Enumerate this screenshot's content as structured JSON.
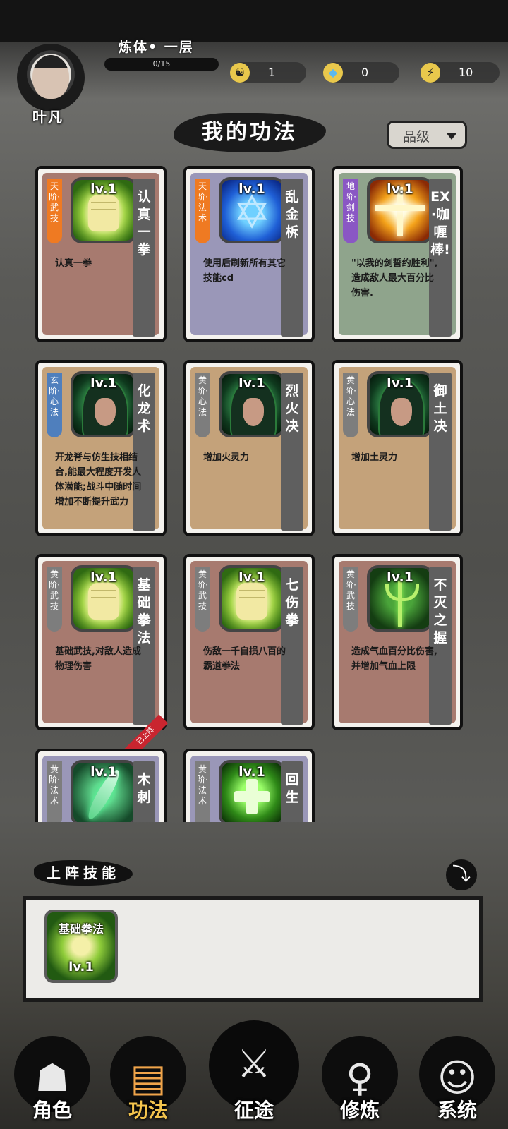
{
  "player": {
    "name": "叶凡",
    "realm": "炼体• 一层",
    "exp": "0/15"
  },
  "resources": [
    {
      "icon": "yin-yang-icon",
      "value": "1"
    },
    {
      "icon": "crystal-icon",
      "value": "0"
    },
    {
      "icon": "lightning-icon",
      "value": "10"
    }
  ],
  "header": {
    "title": "我的功法",
    "sort_button": "品级"
  },
  "skills": [
    {
      "level": "lv.1",
      "grade": "天阶·武技",
      "name": "认真一拳",
      "desc": "认真一拳",
      "grade_color": "#ef7a22",
      "bg": "#a77a6f",
      "icon": "fist"
    },
    {
      "level": "lv.1",
      "grade": "天阶·法术",
      "name": "乱金柝",
      "desc": "使用后刷新所有其它技能cd",
      "grade_color": "#ef7a22",
      "bg": "#9a97b8",
      "icon": "star"
    },
    {
      "level": "lv.1",
      "grade": "地阶·剑技",
      "name": "EX·咖喱棒!",
      "desc": "\"以我的剑誓约胜利\",造成敌人最大百分比伤害.",
      "grade_color": "#8a57c4",
      "bg": "#8fa48c",
      "icon": "cross"
    },
    {
      "level": "lv.1",
      "grade": "玄阶·心法",
      "name": "化龙术",
      "desc": "开龙脊与仿生技相结合,能最大程度开发人体潜能;战斗中随时间增加不断提升武力",
      "grade_color": "#4f7fbd",
      "bg": "#c4a27a",
      "icon": "hood"
    },
    {
      "level": "lv.1",
      "grade": "黄阶·心法",
      "name": "烈火决",
      "desc": "增加火灵力",
      "grade_color": "#7d7d7d",
      "bg": "#c4a27a",
      "icon": "hood"
    },
    {
      "level": "lv.1",
      "grade": "黄阶·心法",
      "name": "御土决",
      "desc": "增加土灵力",
      "grade_color": "#7d7d7d",
      "bg": "#c4a27a",
      "icon": "hood"
    },
    {
      "level": "lv.1",
      "grade": "黄阶·武技",
      "name": "基础拳法",
      "desc": "基础武技,对敌人造成物理伤害",
      "grade_color": "#7d7d7d",
      "bg": "#a77a6f",
      "icon": "fist",
      "ribbon": "已上阵"
    },
    {
      "level": "lv.1",
      "grade": "黄阶·武技",
      "name": "七伤拳",
      "desc": "伤敌一千自损八百的霸道拳法",
      "grade_color": "#7d7d7d",
      "bg": "#a77a6f",
      "icon": "fist"
    },
    {
      "level": "lv.1",
      "grade": "黄阶·武技",
      "name": "不灭之握",
      "desc": "造成气血百分比伤害,并增加气血上限",
      "grade_color": "#7d7d7d",
      "bg": "#a77a6f",
      "icon": "trident"
    },
    {
      "level": "lv.1",
      "grade": "黄阶·法术",
      "name": "木刺",
      "desc": "",
      "grade_color": "#7d7d7d",
      "bg": "#9a97b8",
      "icon": "leaf"
    },
    {
      "level": "lv.1",
      "grade": "黄阶·法术",
      "name": "回生",
      "desc": "",
      "grade_color": "#7d7d7d",
      "bg": "#9a97b8",
      "icon": "plus"
    }
  ],
  "lineup": {
    "title": "上阵技能",
    "collapse_icon": "arrow-down-icon",
    "slots": [
      {
        "name": "基础拳法",
        "level": "lv.1"
      }
    ]
  },
  "nav": {
    "character": "角色",
    "skills": "功法",
    "journey": "征途",
    "cultivate": "修炼",
    "system": "系统"
  }
}
